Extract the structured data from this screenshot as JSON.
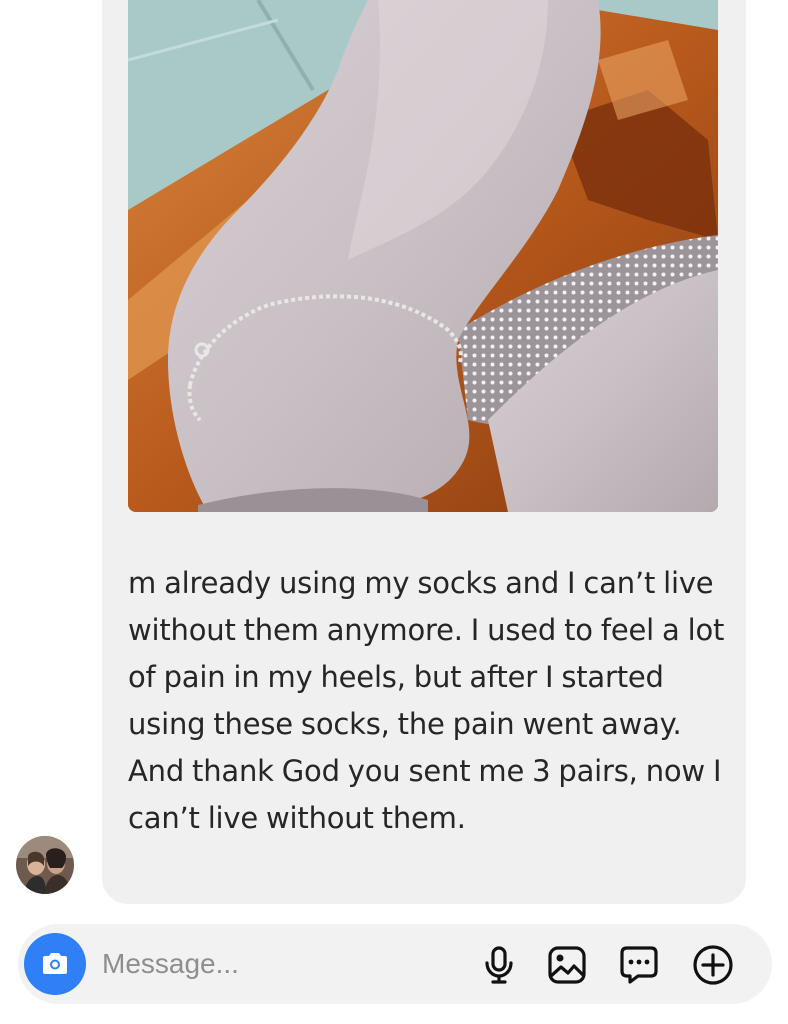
{
  "message": {
    "text": "m already using my socks and I can’t live without them anymore. I used to feel a lot of pain in my heels, but after I started using these socks, the pain went away. And thank God you sent me 3 pairs, now I can’t live without them."
  },
  "composer": {
    "placeholder": "Message...",
    "value": ""
  },
  "icons": {
    "camera": "camera-icon",
    "microphone": "microphone-icon",
    "gallery": "image-icon",
    "sticker": "chat-bubble-icon",
    "add": "plus-circle-icon"
  },
  "colors": {
    "accent": "#2f80f7",
    "bubble": "#f0f0f0",
    "text": "#262626",
    "placeholder": "#8e8e8e"
  }
}
